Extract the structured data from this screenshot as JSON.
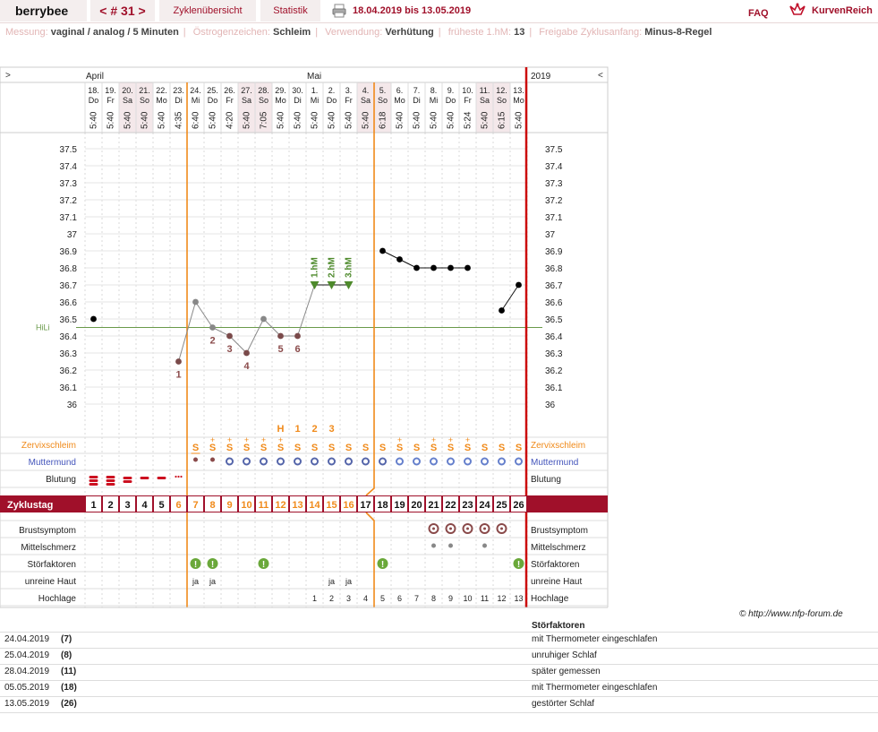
{
  "topbar": {
    "user": "berrybee",
    "cycle": "< # 31 >",
    "overview": "Zyklenübersicht",
    "statistics": "Statistik",
    "date_range": "18.04.2019 bis 13.05.2019",
    "faq": "FAQ",
    "brand": "KurvenReich"
  },
  "meta": [
    {
      "key": "Messung:",
      "value": "vaginal / analog / 5 Minuten"
    },
    {
      "key": "Östrogenzeichen:",
      "value": "Schleim"
    },
    {
      "key": "Verwendung:",
      "value": "Verhütung"
    },
    {
      "key": "früheste 1.hM:",
      "value": "13"
    },
    {
      "key": "Freigabe Zyklusanfang:",
      "value": "Minus-8-Regel"
    }
  ],
  "chart_data": {
    "type": "line",
    "months": [
      {
        "label": "April",
        "day_index": 0
      },
      {
        "label": "Mai",
        "day_index": 13
      }
    ],
    "year_label": "2019",
    "nav_left": ">",
    "nav_right": "<",
    "dates": [
      "18.",
      "19.",
      "20.",
      "21.",
      "22.",
      "23.",
      "24.",
      "25.",
      "26.",
      "27.",
      "28.",
      "29.",
      "30.",
      "1.",
      "2.",
      "3.",
      "4.",
      "5.",
      "6.",
      "7.",
      "8.",
      "9.",
      "10.",
      "11.",
      "12.",
      "13."
    ],
    "weekdays": [
      "Do",
      "Fr",
      "Sa",
      "So",
      "Mo",
      "Di",
      "Mi",
      "Do",
      "Fr",
      "Sa",
      "So",
      "Mo",
      "Di",
      "Mi",
      "Do",
      "Fr",
      "Sa",
      "So",
      "Mo",
      "Di",
      "Mi",
      "Do",
      "Fr",
      "Sa",
      "So",
      "Mo"
    ],
    "weekend_days": [
      2,
      3,
      9,
      10,
      16,
      17,
      23,
      24
    ],
    "times": [
      "5:40",
      "5:40",
      "5:40",
      "5:40",
      "5:40",
      "4:35",
      "6:40",
      "5:40",
      "4:20",
      "5:40",
      "7:05",
      "5:40",
      "5:40",
      "5:40",
      "5:40",
      "5:40",
      "5:40",
      "6:18",
      "5:40",
      "5:40",
      "5:40",
      "5:40",
      "5:24",
      "5:40",
      "6:15",
      "5:40"
    ],
    "cycle_days": [
      "1",
      "2",
      "3",
      "4",
      "5",
      "6",
      "7",
      "8",
      "9",
      "10",
      "11",
      "12",
      "13",
      "14",
      "15",
      "16",
      "17",
      "18",
      "19",
      "20",
      "21",
      "22",
      "23",
      "24",
      "25",
      "26"
    ],
    "cycle_day_highlight": [
      5,
      6,
      7,
      8,
      9,
      10,
      11,
      12,
      13,
      14,
      15
    ],
    "ylim": [
      35.95,
      37.55
    ],
    "y_ticks": [
      "37.5",
      "37.4",
      "37.3",
      "37.2",
      "37.1",
      "37",
      "36.9",
      "36.8",
      "36.7",
      "36.6",
      "36.5",
      "36.4",
      "36.3",
      "36.2",
      "36.1",
      "36"
    ],
    "temperatures": [
      36.5,
      null,
      null,
      null,
      null,
      36.25,
      36.6,
      36.45,
      36.4,
      36.3,
      36.5,
      36.4,
      36.4,
      36.7,
      36.7,
      36.7,
      null,
      36.9,
      36.85,
      36.8,
      36.8,
      36.8,
      36.8,
      null,
      36.55,
      36.7
    ],
    "disturbed_days": [
      6,
      7,
      10,
      17,
      25
    ],
    "hili": {
      "label": "HiLi",
      "value": 36.45
    },
    "low_labels": [
      {
        "day": 5,
        "text": "1"
      },
      {
        "day": 7,
        "text": "2"
      },
      {
        "day": 8,
        "text": "3"
      },
      {
        "day": 9,
        "text": "4"
      },
      {
        "day": 11,
        "text": "5"
      },
      {
        "day": 12,
        "text": "6"
      }
    ],
    "high_markers": [
      {
        "day": 13,
        "text": "1.hM"
      },
      {
        "day": 14,
        "text": "2.hM"
      },
      {
        "day": 15,
        "text": "3.hM"
      }
    ],
    "mucus_peak_labels": [
      {
        "day": 11,
        "text": "H"
      },
      {
        "day": 12,
        "text": "1"
      },
      {
        "day": 13,
        "text": "2"
      },
      {
        "day": 14,
        "text": "3"
      }
    ],
    "vertical_lines": [
      5,
      16
    ],
    "symptom_labels": {
      "cervix_mucus": "Zervixschleim",
      "cervix": "Muttermund",
      "bleeding": "Blutung",
      "cycle_day": "Zyklustag",
      "breast": "Brustsymptom",
      "mittelschmerz": "Mittelschmerz",
      "disturbances": "Störfaktoren",
      "skin": "unreine Haut",
      "position": "Hochlage"
    },
    "cervix_mucus": [
      "",
      "",
      "",
      "",
      "",
      "",
      "S",
      "S+",
      "S+",
      "S+",
      "S+",
      "S+",
      "S",
      "S",
      "S",
      "S",
      "S",
      "S",
      "S+",
      "S",
      "S+",
      "S+",
      "S+",
      "S",
      "S",
      "S"
    ],
    "cervix": [
      "",
      "",
      "",
      "",
      "",
      "",
      "dot",
      "dot",
      "ring",
      "ring",
      "ring",
      "ring",
      "ring",
      "ring",
      "ring",
      "ring",
      "ring",
      "ring",
      "ring",
      "ring",
      "ring",
      "ring",
      "ring",
      "ring",
      "ring",
      "ring"
    ],
    "bleeding": [
      "stark",
      "stark",
      "mittel",
      "schwach",
      "schwach",
      "schmierblutung",
      "",
      "",
      "",
      "",
      "",
      "",
      "",
      "",
      "",
      "",
      "",
      "",
      "",
      "",
      "",
      "",
      "",
      "",
      "",
      ""
    ],
    "breast": [
      "",
      "",
      "",
      "",
      "",
      "",
      "",
      "",
      "",
      "",
      "",
      "",
      "",
      "",
      "",
      "",
      "",
      "",
      "",
      "",
      "x",
      "x",
      "x",
      "x",
      "x",
      ""
    ],
    "mittelschmerz": [
      "",
      "",
      "",
      "",
      "",
      "",
      "",
      "",
      "",
      "",
      "",
      "",
      "",
      "",
      "",
      "",
      "",
      "",
      "",
      "",
      "x",
      "x",
      "",
      "x",
      "",
      ""
    ],
    "disturbance_marks": [
      "",
      "",
      "",
      "",
      "",
      "",
      "!",
      "!",
      "",
      "",
      "!",
      "",
      "",
      "",
      "",
      "",
      "",
      "!",
      "",
      "",
      "",
      "",
      "",
      "",
      "",
      "!"
    ],
    "skin": [
      "",
      "",
      "",
      "",
      "",
      "",
      "ja",
      "ja",
      "",
      "",
      "",
      "",
      "",
      "",
      "ja",
      "ja",
      "",
      "",
      "",
      "",
      "",
      "",
      "",
      "",
      "",
      ""
    ],
    "position": [
      "",
      "",
      "",
      "",
      "",
      "",
      "",
      "",
      "",
      "",
      "",
      "",
      "",
      "1",
      "2",
      "3",
      "4",
      "5",
      "6",
      "7",
      "8",
      "9",
      "10",
      "11",
      "12",
      "13"
    ]
  },
  "notes": {
    "header": "Störfaktoren",
    "copyright": "© http://www.nfp-forum.de",
    "rows": [
      {
        "date": "24.04.2019",
        "cycle_day": "(7)",
        "text": "mit Thermometer eingeschlafen"
      },
      {
        "date": "25.04.2019",
        "cycle_day": "(8)",
        "text": "unruhiger Schlaf"
      },
      {
        "date": "28.04.2019",
        "cycle_day": "(11)",
        "text": "später gemessen"
      },
      {
        "date": "05.05.2019",
        "cycle_day": "(18)",
        "text": "mit Thermometer eingeschlafen"
      },
      {
        "date": "13.05.2019",
        "cycle_day": "(26)",
        "text": "gestörter Schlaf"
      }
    ]
  },
  "colors": {
    "accent": "#a0102a",
    "orange": "#f08a1a",
    "hili": "#6a9a4a",
    "high_marker": "#4e8a2c",
    "low_label": "#8a4a4a",
    "cervix_blue": "#4455bb",
    "disturbance_green": "#6aa83a"
  }
}
